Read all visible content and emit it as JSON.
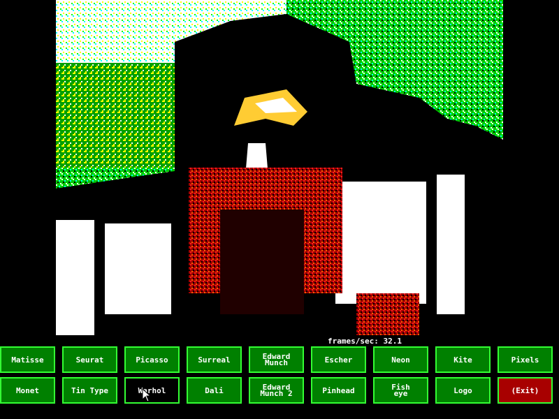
{
  "status": {
    "fps_label": "frames/sec:",
    "fps_value": "32.1"
  },
  "colors": {
    "button_bg": "#008000",
    "button_border": "#33ff33",
    "selected_bg": "#000000",
    "exit_bg": "#a80000",
    "text": "#ffffff"
  },
  "camera": {
    "icon": "webcam-feed"
  },
  "buttons": {
    "row1": [
      "Matisse",
      "Seurat",
      "Picasso",
      "Surreal",
      "Edward\nMunch",
      "Escher",
      "Neon",
      "Kite",
      "Pixels"
    ],
    "row2": [
      "Monet",
      "Tin Type",
      "Warhol",
      "Dali",
      "Edward\nMunch 2",
      "Pinhead",
      "Fish\neye",
      "Logo",
      "(Exit)"
    ]
  },
  "selected_filter": "Warhol"
}
